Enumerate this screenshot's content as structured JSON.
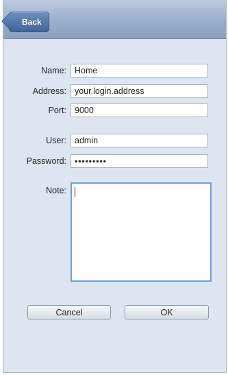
{
  "navbar": {
    "back_label": "Back"
  },
  "form": {
    "name": {
      "label": "Name:",
      "value": "Home"
    },
    "address": {
      "label": "Address:",
      "value": "your.login.address"
    },
    "port": {
      "label": "Port:",
      "value": "9000"
    },
    "user": {
      "label": "User:",
      "value": "admin"
    },
    "password": {
      "label": "Password:",
      "value": "•••••••••"
    },
    "note": {
      "label": "Note:",
      "value": ""
    }
  },
  "actions": {
    "cancel_label": "Cancel",
    "ok_label": "OK"
  }
}
